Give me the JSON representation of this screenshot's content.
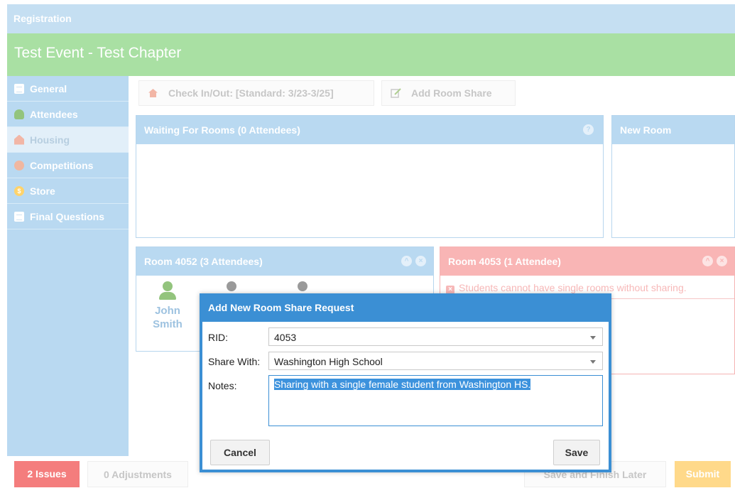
{
  "window": {
    "title": "Registration"
  },
  "event": {
    "title": "Test Event - Test Chapter"
  },
  "sidebar": {
    "items": [
      {
        "label": "General",
        "icon": "document-icon"
      },
      {
        "label": "Attendees",
        "icon": "user-icon"
      },
      {
        "label": "Housing",
        "icon": "house-icon"
      },
      {
        "label": "Competitions",
        "icon": "ribbon-icon"
      },
      {
        "label": "Store",
        "icon": "coin-icon"
      },
      {
        "label": "Final Questions",
        "icon": "document-icon"
      }
    ],
    "active": "Housing"
  },
  "toolbar": {
    "checkin_label": "Check In/Out: [Standard: 3/23-3/25]",
    "add_room_share_label": "Add Room Share"
  },
  "panels": {
    "waiting": {
      "title": "Waiting For Rooms (0 Attendees)",
      "help": "?"
    },
    "new_room": {
      "title": "New Room"
    },
    "room_4052": {
      "title": "Room 4052 (3 Attendees)",
      "attendee_first": "John",
      "attendee_last": "Smith"
    },
    "room_4053": {
      "title": "Room 4053 (1 Attendee)",
      "warning": "Students cannot have single rooms without sharing."
    }
  },
  "footer": {
    "issues_label": "2 Issues",
    "adjustments_label": "0 Adjustments",
    "save_later_label": "Save and Finish Later",
    "submit_label": "Submit"
  },
  "dialog": {
    "title": "Add New Room Share Request",
    "rid_label": "RID:",
    "rid_value": "4053",
    "share_label": "Share With:",
    "share_value": "Washington High School",
    "notes_label": "Notes:",
    "notes_value": "Sharing with a single female student from Washington HS.",
    "cancel_label": "Cancel",
    "save_label": "Save"
  },
  "colors": {
    "title_bar": "#c5dff2",
    "event_bar": "#a9e0a3",
    "accent_blue": "#3b8fd4",
    "warning_red": "#f9b5b5",
    "issues_red": "#f47d7d",
    "submit_yellow": "#ffd98a"
  }
}
